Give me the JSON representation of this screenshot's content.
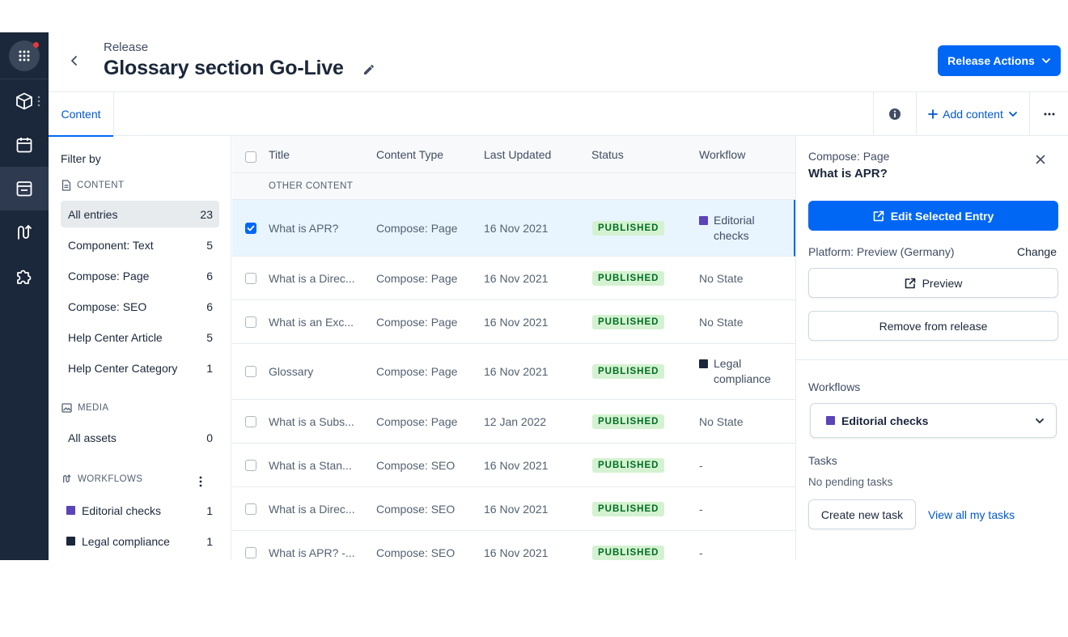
{
  "header": {
    "breadcrumb": "Release",
    "title": "Glossary section Go-Live",
    "release_actions_label": "Release Actions"
  },
  "tabs": {
    "content_label": "Content",
    "add_content_label": "Add content"
  },
  "filters": {
    "filter_by": "Filter by",
    "content_heading": "CONTENT",
    "content_items": [
      {
        "label": "All entries",
        "count": "23"
      },
      {
        "label": "Component: Text",
        "count": "5"
      },
      {
        "label": "Compose: Page",
        "count": "6"
      },
      {
        "label": "Compose: SEO",
        "count": "6"
      },
      {
        "label": "Help Center Article",
        "count": "5"
      },
      {
        "label": "Help Center Category",
        "count": "1"
      }
    ],
    "media_heading": "MEDIA",
    "media_items": [
      {
        "label": "All assets",
        "count": "0"
      }
    ],
    "workflows_heading": "WORKFLOWS",
    "workflow_items": [
      {
        "label": "Editorial checks",
        "count": "1"
      },
      {
        "label": "Legal compliance",
        "count": "1"
      }
    ]
  },
  "table": {
    "columns": {
      "title": "Title",
      "content_type": "Content Type",
      "last_updated": "Last Updated",
      "status": "Status",
      "workflow": "Workflow"
    },
    "group_label": "OTHER CONTENT",
    "rows": [
      {
        "title": "What is APR?",
        "type": "Compose: Page",
        "updated": "16 Nov 2021",
        "status": "PUBLISHED",
        "workflow": "Editorial checks"
      },
      {
        "title": "What is a Direc...",
        "type": "Compose: Page",
        "updated": "16 Nov 2021",
        "status": "PUBLISHED",
        "workflow": "No State"
      },
      {
        "title": "What is an Exc...",
        "type": "Compose: Page",
        "updated": "16 Nov 2021",
        "status": "PUBLISHED",
        "workflow": "No State"
      },
      {
        "title": "Glossary",
        "type": "Compose: Page",
        "updated": "16 Nov 2021",
        "status": "PUBLISHED",
        "workflow": "Legal compliance"
      },
      {
        "title": "What is a Subs...",
        "type": "Compose: Page",
        "updated": "12 Jan 2022",
        "status": "PUBLISHED",
        "workflow": "No State"
      },
      {
        "title": "What is a Stan...",
        "type": "Compose: SEO",
        "updated": "16 Nov 2021",
        "status": "PUBLISHED",
        "workflow": "-"
      },
      {
        "title": "What is a Direc...",
        "type": "Compose: SEO",
        "updated": "16 Nov 2021",
        "status": "PUBLISHED",
        "workflow": "-"
      },
      {
        "title": "What is APR? -...",
        "type": "Compose: SEO",
        "updated": "16 Nov 2021",
        "status": "PUBLISHED",
        "workflow": "-"
      }
    ]
  },
  "side": {
    "content_type": "Compose: Page",
    "entry_title": "What is APR?",
    "edit_label": "Edit Selected Entry",
    "platform": "Platform: Preview (Germany)",
    "change_label": "Change",
    "preview_label": "Preview",
    "remove_label": "Remove from release",
    "workflows_label": "Workflows",
    "workflow_selected": "Editorial checks",
    "tasks_label": "Tasks",
    "no_tasks": "No pending tasks",
    "create_task_label": "Create new task",
    "view_tasks_label": "View all my tasks"
  },
  "colors": {
    "primary": "#0067f5",
    "rail_bg": "#1b273a",
    "editorial": "#5b43b8",
    "legal": "#1b273a",
    "published_bg": "#d4f2d1",
    "published_text": "#006d23"
  }
}
